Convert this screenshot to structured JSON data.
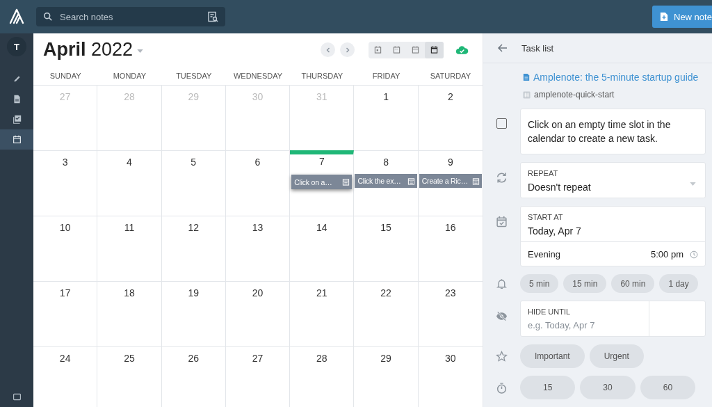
{
  "search": {
    "placeholder": "Search notes"
  },
  "new_note_button": "New note",
  "sidebar": {
    "avatar": "T",
    "items": [
      {
        "kind": "edit",
        "selected": false
      },
      {
        "kind": "notes",
        "selected": false
      },
      {
        "kind": "tasks",
        "selected": false
      },
      {
        "kind": "calendar",
        "selected": true
      }
    ]
  },
  "calendar": {
    "month": "April",
    "year": "2022",
    "views": [
      {
        "kind": "day",
        "selected": false
      },
      {
        "kind": "week",
        "selected": false
      },
      {
        "kind": "agenda",
        "selected": false
      },
      {
        "kind": "month",
        "selected": true
      }
    ],
    "weekdays": [
      "SUNDAY",
      "MONDAY",
      "TUESDAY",
      "WEDNESDAY",
      "THURSDAY",
      "FRIDAY",
      "SATURDAY"
    ],
    "weeks": [
      [
        {
          "day": "27",
          "outside": true,
          "today": false
        },
        {
          "day": "28",
          "outside": true,
          "today": false
        },
        {
          "day": "29",
          "outside": true,
          "today": false
        },
        {
          "day": "30",
          "outside": true,
          "today": false
        },
        {
          "day": "31",
          "outside": true,
          "today": false
        },
        {
          "day": "1",
          "outside": false,
          "today": false
        },
        {
          "day": "2",
          "outside": false,
          "today": false
        }
      ],
      [
        {
          "day": "3",
          "outside": false,
          "today": false
        },
        {
          "day": "4",
          "outside": false,
          "today": false
        },
        {
          "day": "5",
          "outside": false,
          "today": false
        },
        {
          "day": "6",
          "outside": false,
          "today": false
        },
        {
          "day": "7",
          "outside": false,
          "today": true,
          "events": [
            {
              "label": "Click on a…",
              "selected": true
            }
          ]
        },
        {
          "day": "8",
          "outside": false,
          "today": false,
          "events": [
            {
              "label": "Click the ex…",
              "selected": false
            }
          ]
        },
        {
          "day": "9",
          "outside": false,
          "today": false,
          "events": [
            {
              "label": "Create a Ric…",
              "selected": false
            }
          ]
        }
      ],
      [
        {
          "day": "10",
          "outside": false,
          "today": false
        },
        {
          "day": "11",
          "outside": false,
          "today": false
        },
        {
          "day": "12",
          "outside": false,
          "today": false
        },
        {
          "day": "13",
          "outside": false,
          "today": false
        },
        {
          "day": "14",
          "outside": false,
          "today": false
        },
        {
          "day": "15",
          "outside": false,
          "today": false
        },
        {
          "day": "16",
          "outside": false,
          "today": false
        }
      ],
      [
        {
          "day": "17",
          "outside": false,
          "today": false
        },
        {
          "day": "18",
          "outside": false,
          "today": false
        },
        {
          "day": "19",
          "outside": false,
          "today": false
        },
        {
          "day": "20",
          "outside": false,
          "today": false
        },
        {
          "day": "21",
          "outside": false,
          "today": false
        },
        {
          "day": "22",
          "outside": false,
          "today": false
        },
        {
          "day": "23",
          "outside": false,
          "today": false
        }
      ],
      [
        {
          "day": "24",
          "outside": false,
          "today": false
        },
        {
          "day": "25",
          "outside": false,
          "today": false
        },
        {
          "day": "26",
          "outside": false,
          "today": false
        },
        {
          "day": "27",
          "outside": false,
          "today": false
        },
        {
          "day": "28",
          "outside": false,
          "today": false
        },
        {
          "day": "29",
          "outside": false,
          "today": false
        },
        {
          "day": "30",
          "outside": false,
          "today": false
        }
      ]
    ]
  },
  "task_panel": {
    "title": "Task list",
    "note_link": "Amplenote: the 5-minute startup guide",
    "tag": "amplenote-quick-start",
    "task": {
      "checked": false,
      "text": "Click on an empty time slot in the calendar to create a new task."
    },
    "repeat": {
      "label": "REPEAT",
      "value": "Doesn't repeat"
    },
    "start_at": {
      "label": "START AT",
      "value": "Today, Apr 7",
      "time_of_day": "Evening",
      "time": "5:00 pm"
    },
    "reminders": [
      "5 min",
      "15 min",
      "60 min",
      "1 day"
    ],
    "hide_until": {
      "label": "HIDE UNTIL",
      "placeholder": "e.g. Today, Apr 7"
    },
    "flags": [
      "Important",
      "Urgent"
    ],
    "durations": [
      "15",
      "30",
      "60"
    ]
  }
}
